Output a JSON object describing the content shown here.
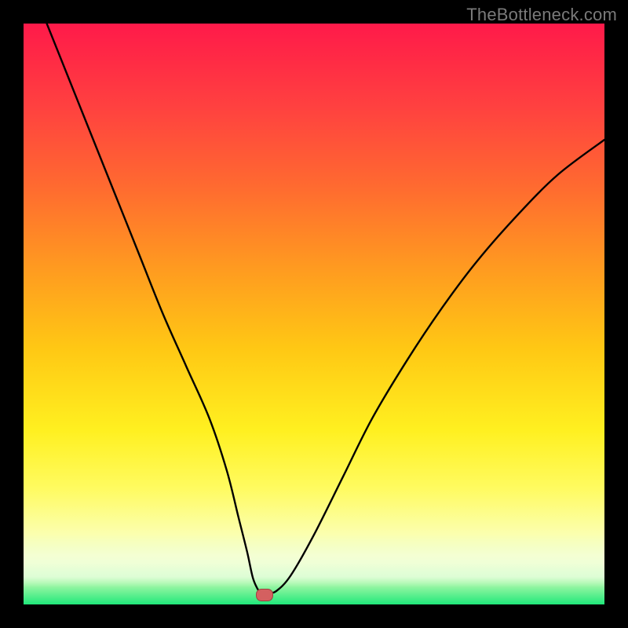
{
  "watermark": "TheBottleneck.com",
  "chart_data": {
    "type": "line",
    "title": "",
    "xlabel": "",
    "ylabel": "",
    "xlim": [
      0,
      100
    ],
    "ylim": [
      0,
      100
    ],
    "series": [
      {
        "name": "bottleneck-curve",
        "x": [
          4,
          8,
          12,
          16,
          20,
          24,
          28,
          32,
          35,
          37,
          38.5,
          39.5,
          40.5,
          41,
          42,
          43.5,
          46,
          50,
          55,
          60,
          66,
          72,
          78,
          85,
          92,
          100
        ],
        "values": [
          100,
          90,
          80,
          70,
          60,
          50,
          41,
          32,
          23,
          15,
          9,
          4.5,
          2.3,
          2.0,
          2.0,
          2.3,
          5,
          12,
          22,
          32,
          42,
          51,
          59,
          67,
          74,
          80
        ]
      }
    ],
    "annotations": [
      {
        "name": "optimal-marker",
        "x": 41.5,
        "y": 1.6
      }
    ],
    "background": {
      "type": "vertical-gradient",
      "stops": [
        {
          "pos": 0,
          "color": "#ff1a4a"
        },
        {
          "pos": 50,
          "color": "#ffb020"
        },
        {
          "pos": 75,
          "color": "#fff048"
        },
        {
          "pos": 100,
          "color": "#20e87a"
        }
      ]
    }
  }
}
